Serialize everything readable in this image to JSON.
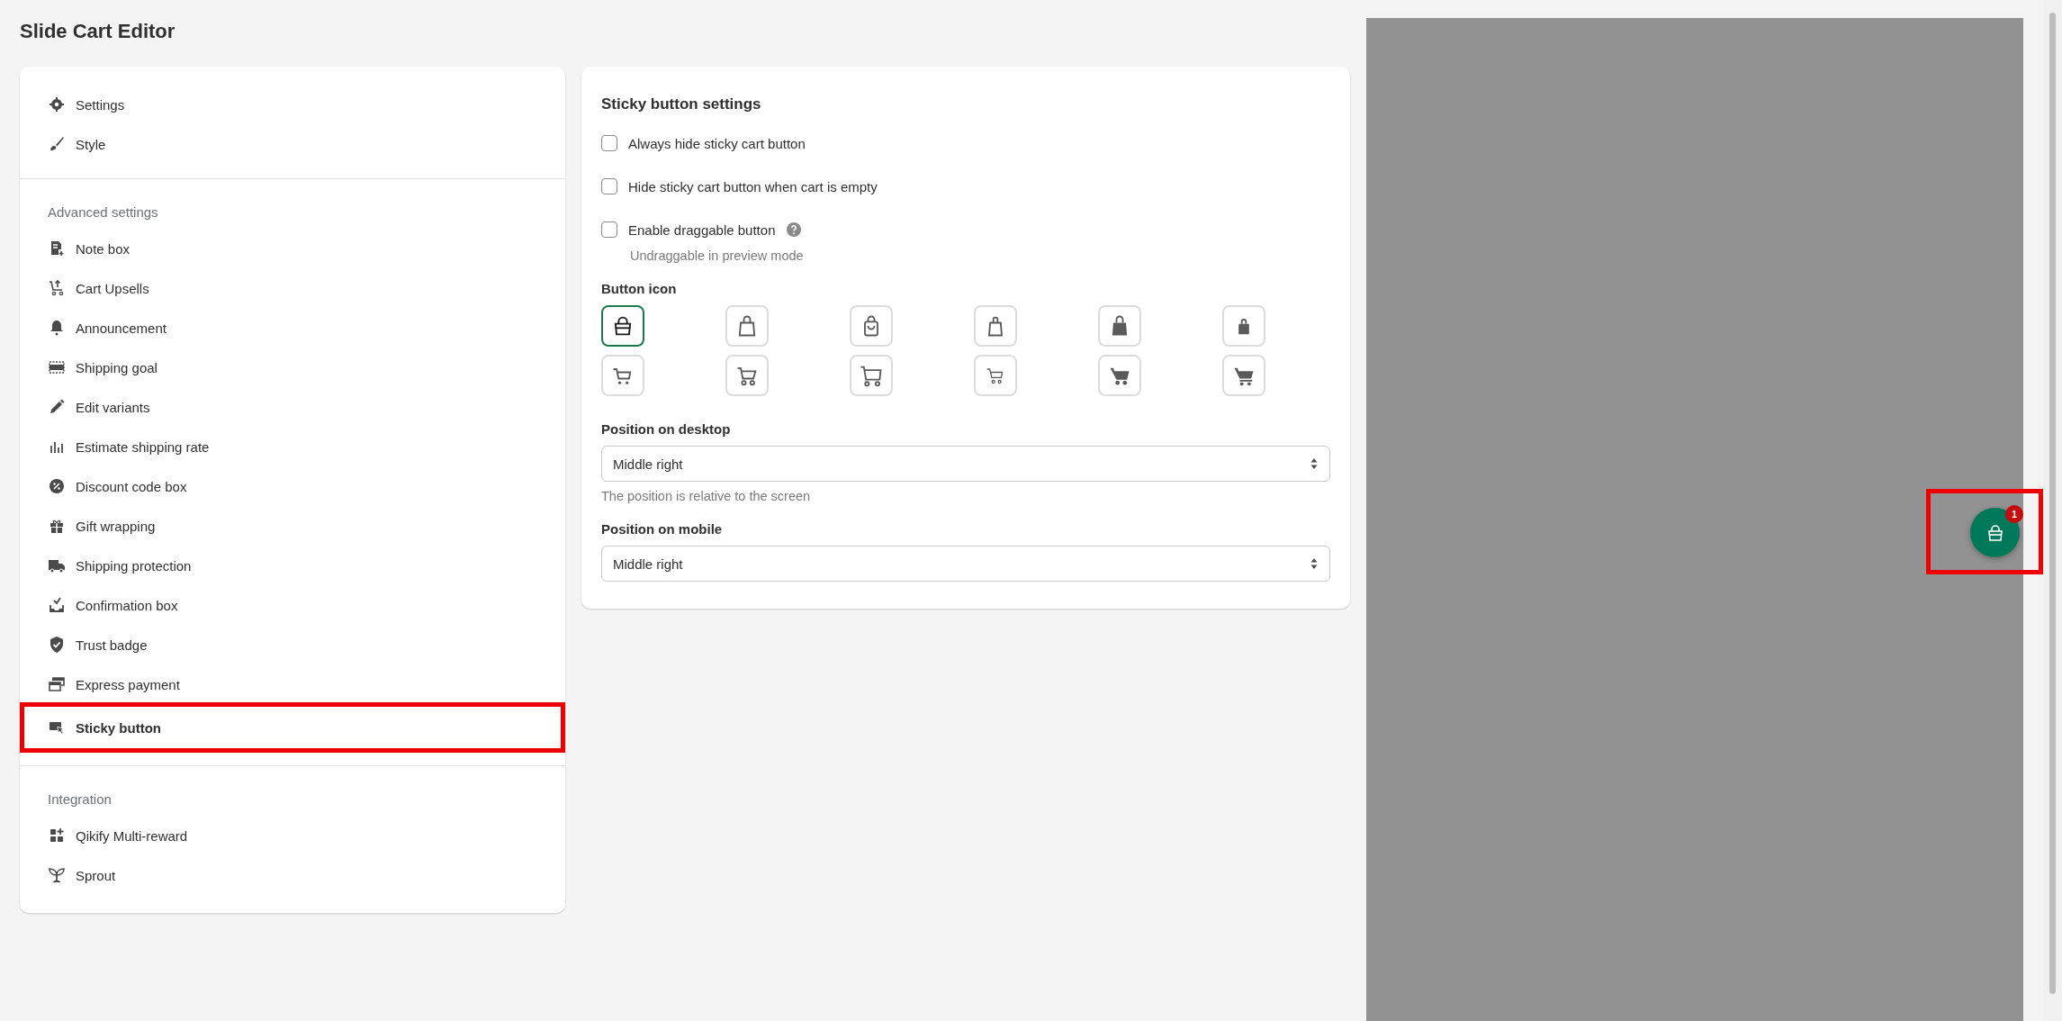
{
  "page_title": "Slide Cart Editor",
  "sidebar": {
    "groups": [
      {
        "items": [
          {
            "label": "Settings",
            "selected": false
          },
          {
            "label": "Style",
            "selected": false
          }
        ]
      },
      {
        "heading": "Advanced settings",
        "items": [
          {
            "label": "Note box",
            "selected": false
          },
          {
            "label": "Cart Upsells",
            "selected": false
          },
          {
            "label": "Announcement",
            "selected": false
          },
          {
            "label": "Shipping goal",
            "selected": false
          },
          {
            "label": "Edit variants",
            "selected": false
          },
          {
            "label": "Estimate shipping rate",
            "selected": false
          },
          {
            "label": "Discount code box",
            "selected": false
          },
          {
            "label": "Gift wrapping",
            "selected": false
          },
          {
            "label": "Shipping protection",
            "selected": false
          },
          {
            "label": "Confirmation box",
            "selected": false
          },
          {
            "label": "Trust badge",
            "selected": false
          },
          {
            "label": "Express payment",
            "selected": false
          },
          {
            "label": "Sticky button",
            "selected": true
          }
        ]
      },
      {
        "heading": "Integration",
        "items": [
          {
            "label": "Qikify Multi-reward",
            "selected": false
          },
          {
            "label": "Sprout",
            "selected": false
          }
        ]
      }
    ]
  },
  "panel": {
    "title": "Sticky button settings",
    "checkboxes": [
      {
        "label": "Always hide sticky cart button",
        "checked": false
      },
      {
        "label": "Hide sticky cart button when cart is empty",
        "checked": false
      },
      {
        "label": "Enable draggable button",
        "checked": false,
        "help": "Undraggable in preview mode"
      }
    ],
    "icon_label": "Button icon",
    "icons": [
      {
        "kind": "handbag",
        "selected": true
      },
      {
        "kind": "tote",
        "selected": false
      },
      {
        "kind": "smilebag",
        "selected": false
      },
      {
        "kind": "slimbag",
        "selected": false
      },
      {
        "kind": "solidbag",
        "selected": false
      },
      {
        "kind": "smallbag",
        "selected": false
      },
      {
        "kind": "cart",
        "selected": false
      },
      {
        "kind": "roundcart",
        "selected": false
      },
      {
        "kind": "bigcart",
        "selected": false
      },
      {
        "kind": "thincart",
        "selected": false
      },
      {
        "kind": "solidcart",
        "selected": false
      },
      {
        "kind": "flatcart",
        "selected": false
      }
    ],
    "selects": [
      {
        "label": "Position on desktop",
        "value": "Middle right",
        "help": "The position is relative to the screen"
      },
      {
        "label": "Position on mobile",
        "value": "Middle right"
      }
    ]
  },
  "preview": {
    "cart_count": "1",
    "highlighted": true
  }
}
